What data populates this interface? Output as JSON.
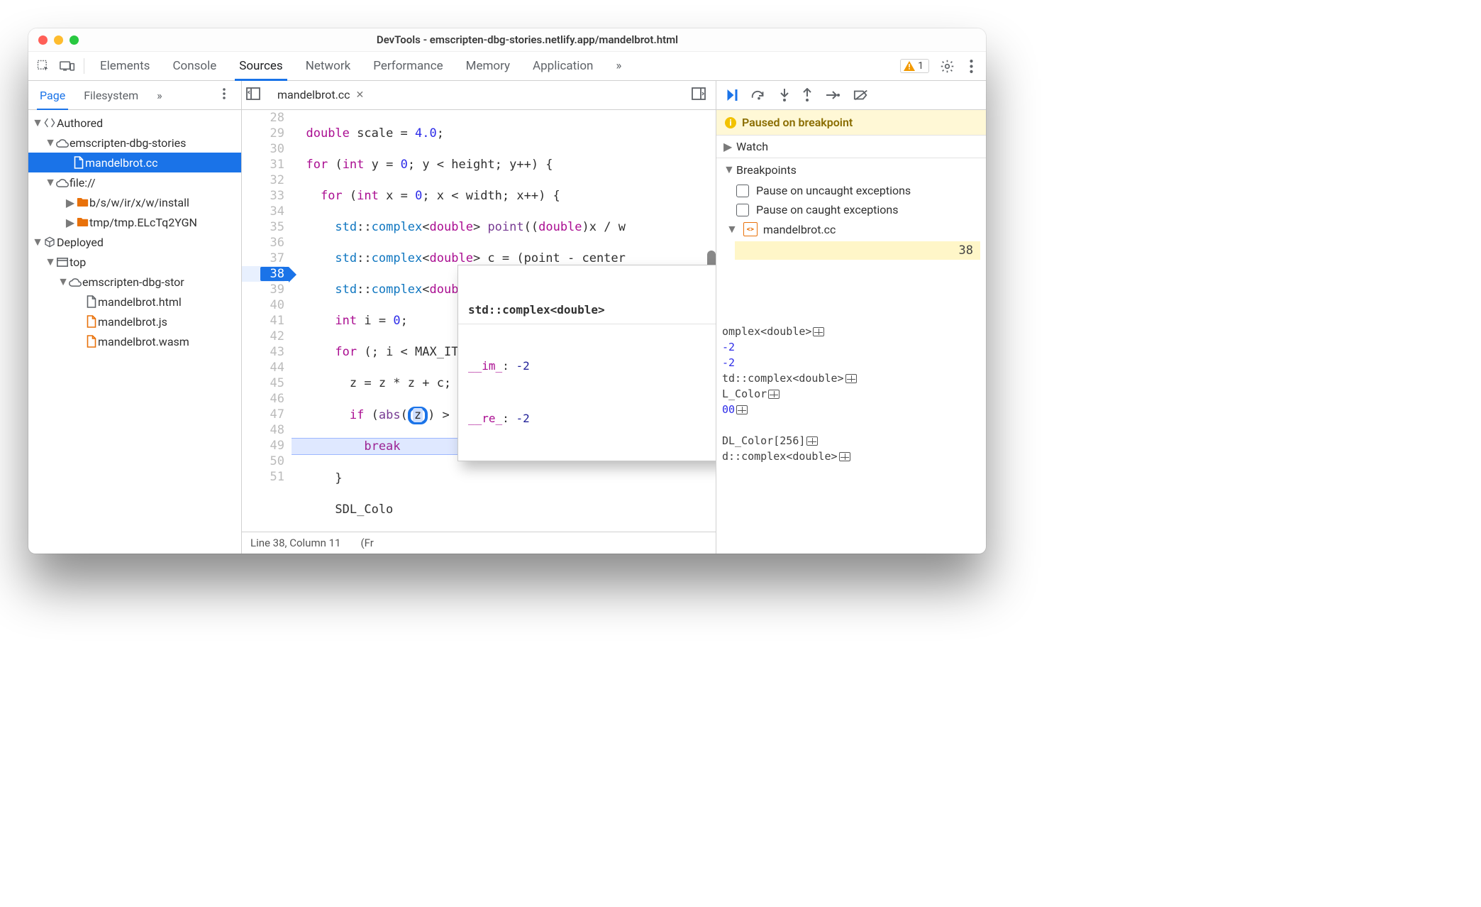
{
  "window_title": "DevTools - emscripten-dbg-stories.netlify.app/mandelbrot.html",
  "main_tabs": {
    "elements": "Elements",
    "console": "Console",
    "sources": "Sources",
    "network": "Network",
    "performance": "Performance",
    "memory": "Memory",
    "application": "Application"
  },
  "warning_count": "1",
  "nav_tabs": {
    "page": "Page",
    "filesystem": "Filesystem"
  },
  "tree": {
    "authored": "Authored",
    "domain1": "emscripten-dbg-stories",
    "openfile": "mandelbrot.cc",
    "fileproto": "file://",
    "install": "b/s/w/ir/x/w/install",
    "tmp": "tmp/tmp.ELcTq2YGN",
    "deployed": "Deployed",
    "top": "top",
    "domain2": "emscripten-dbg-stor",
    "f_html": "mandelbrot.html",
    "f_js": "mandelbrot.js",
    "f_wasm": "mandelbrot.wasm"
  },
  "editor_tab": "mandelbrot.cc",
  "gutter": [
    "28",
    "29",
    "30",
    "31",
    "32",
    "33",
    "34",
    "35",
    "36",
    "37",
    "38",
    "39",
    "40",
    "41",
    "42",
    "43",
    "44",
    "45",
    "46",
    "47",
    "48",
    "49",
    "50",
    "51"
  ],
  "status": {
    "pos": "Line 38, Column 11",
    "extra": "(Fr"
  },
  "hover": {
    "type": "std::complex<double>",
    "rows": [
      {
        "k": "__im_",
        "v": "-2"
      },
      {
        "k": "__re_",
        "v": "-2"
      }
    ]
  },
  "debugger": {
    "paused": "Paused on breakpoint",
    "watch": "Watch",
    "breakpoints": "Breakpoints",
    "pause_uncaught": "Pause on uncaught exceptions",
    "pause_caught": "Pause on caught exceptions",
    "bp_file": "mandelbrot.cc",
    "bp_line": "38",
    "scope": [
      "omplex<double>",
      "-2",
      "-2",
      "td::complex<double>",
      "L_Color",
      "00",
      "",
      "DL_Color[256]",
      "d::complex<double>"
    ]
  }
}
